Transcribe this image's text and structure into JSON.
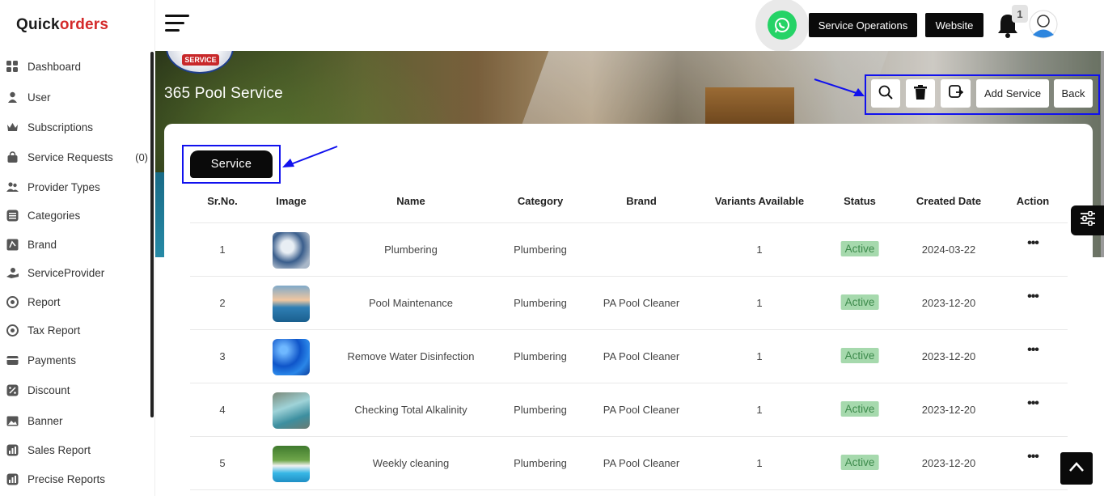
{
  "brand": {
    "logo_part1": "Quick",
    "logo_part2": "orders"
  },
  "sidebar": {
    "items": [
      {
        "label": "Dashboard",
        "icon": "dashboard-icon"
      },
      {
        "label": "User",
        "icon": "user-icon"
      },
      {
        "label": "Subscriptions",
        "icon": "crown-icon"
      },
      {
        "label": "Service Requests",
        "icon": "bag-icon",
        "count": "(0)"
      },
      {
        "label": "Provider Types",
        "icon": "users-icon"
      },
      {
        "label": "Categories",
        "icon": "list-icon"
      },
      {
        "label": "Brand",
        "icon": "brand-icon"
      },
      {
        "label": "ServiceProvider",
        "icon": "hand-icon"
      },
      {
        "label": "Report",
        "icon": "report-icon"
      },
      {
        "label": "Tax Report",
        "icon": "tax-report-icon"
      },
      {
        "label": "Payments",
        "icon": "payments-icon"
      },
      {
        "label": "Discount",
        "icon": "discount-icon"
      },
      {
        "label": "Banner",
        "icon": "image-icon"
      },
      {
        "label": "Sales Report",
        "icon": "sales-report-icon"
      },
      {
        "label": "Precise Reports",
        "icon": "precise-report-icon"
      }
    ]
  },
  "topbar": {
    "service_operations": "Service Operations",
    "website": "Website",
    "notification_count": "1"
  },
  "banner": {
    "logo_tag": "SERVICE",
    "business_name": "365 Pool Service",
    "add_service": "Add Service",
    "back": "Back"
  },
  "tabs": {
    "active": "Service"
  },
  "table": {
    "headers": [
      "Sr.No.",
      "Image",
      "Name",
      "Category",
      "Brand",
      "Variants Available",
      "Status",
      "Created Date",
      "Action"
    ],
    "rows": [
      {
        "sr": "1",
        "name": "Plumbering",
        "category": "Plumbering",
        "brand": "",
        "variants": "1",
        "status": "Active",
        "date": "2024-03-22",
        "action": "•••"
      },
      {
        "sr": "2",
        "name": "Pool Maintenance",
        "category": "Plumbering",
        "brand": "PA Pool Cleaner",
        "variants": "1",
        "status": "Active",
        "date": "2023-12-20",
        "action": "•••"
      },
      {
        "sr": "3",
        "name": "Remove Water Disinfection",
        "category": "Plumbering",
        "brand": "PA Pool Cleaner",
        "variants": "1",
        "status": "Active",
        "date": "2023-12-20",
        "action": "•••"
      },
      {
        "sr": "4",
        "name": "Checking Total Alkalinity",
        "category": "Plumbering",
        "brand": "PA Pool Cleaner",
        "variants": "1",
        "status": "Active",
        "date": "2023-12-20",
        "action": "•••"
      },
      {
        "sr": "5",
        "name": "Weekly cleaning",
        "category": "Plumbering",
        "brand": "PA Pool Cleaner",
        "variants": "1",
        "status": "Active",
        "date": "2023-12-20",
        "action": "•••"
      }
    ]
  },
  "colors": {
    "accent": "#0a0a0a",
    "highlight_box": "#1111ee",
    "status_bg": "#a6d9ad",
    "status_text": "#3c8a4b",
    "logo_red": "#d42a2a"
  }
}
